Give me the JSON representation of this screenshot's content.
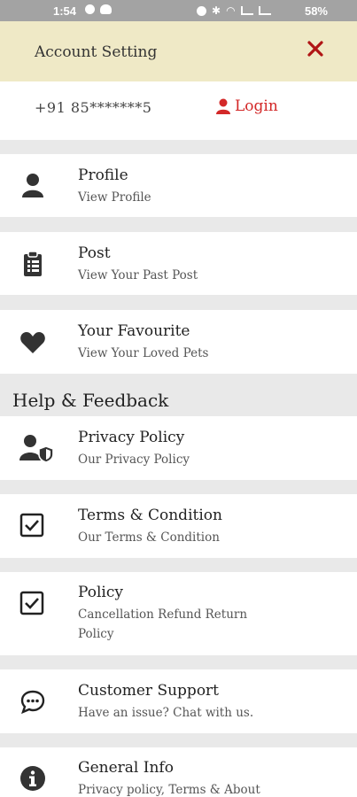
{
  "status_bar": {
    "time": "1:54",
    "battery": "58%",
    "icons": [
      "notification-icon",
      "cloud-icon",
      "alarm-icon",
      "bluetooth-icon",
      "wifi-icon",
      "signal-icon"
    ]
  },
  "header": {
    "title": "Account Setting",
    "close_icon": "close-icon"
  },
  "account": {
    "phone": "+91 85*******5",
    "login_label": "Login"
  },
  "menu": [
    {
      "label": "Profile",
      "sub": "View Profile",
      "icon": "user-icon"
    },
    {
      "label": "Post",
      "sub": "View Your Past Post",
      "icon": "clipboard-icon"
    },
    {
      "label": "Your Favourite",
      "sub": "View Your Loved Pets",
      "icon": "heart-icon"
    }
  ],
  "help_section": {
    "title": "Help & Feedback",
    "items": [
      {
        "label": "Privacy Policy",
        "sub": "Our Privacy Policy",
        "icon": "user-shield-icon"
      },
      {
        "label": "Terms & Condition",
        "sub": "Our Terms & Condition",
        "icon": "checkbox-icon"
      },
      {
        "label": "Policy",
        "sub": "Cancellation Refund Return Policy",
        "icon": "checkbox-icon"
      },
      {
        "label": "Customer Support",
        "sub": "Have an issue? Chat with us.",
        "icon": "chat-icon"
      },
      {
        "label": "General Info",
        "sub": "Privacy policy, Terms & About",
        "icon": "info-icon"
      }
    ]
  },
  "colors": {
    "header_bg": "#efe9c6",
    "accent_red": "#d32828",
    "close_red": "#b01515",
    "divider_bg": "#e9e9e9"
  }
}
